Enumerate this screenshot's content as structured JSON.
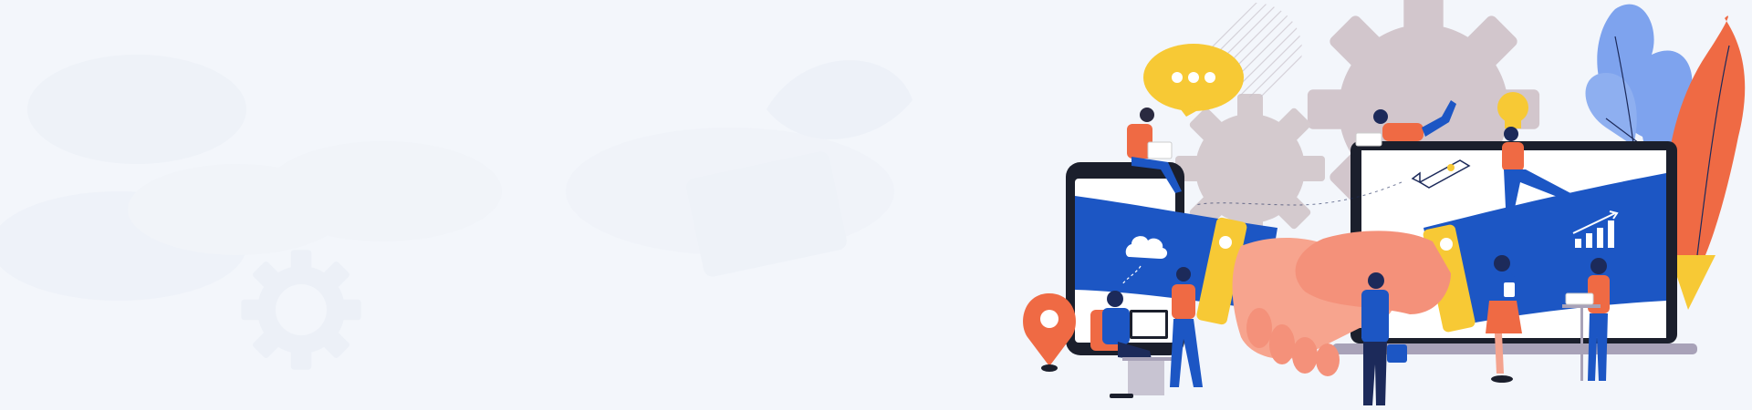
{
  "banner": {
    "colors": {
      "background": "#f3f6fb",
      "blue": "#1c56c4",
      "navy": "#1c2a5a",
      "orange": "#f0643e",
      "coral": "#f4917a",
      "yellow": "#f7c935",
      "gear": "#d2c6cc",
      "plant_blue": "#7ea3ee",
      "plant_orange": "#ef6a44"
    },
    "icons": [
      "chat-bubble-icon",
      "cloud-icon",
      "rocket-icon",
      "lightbulb-icon",
      "growth-chart-icon",
      "location-pin-icon",
      "gear-icon",
      "handshake-icon"
    ]
  }
}
